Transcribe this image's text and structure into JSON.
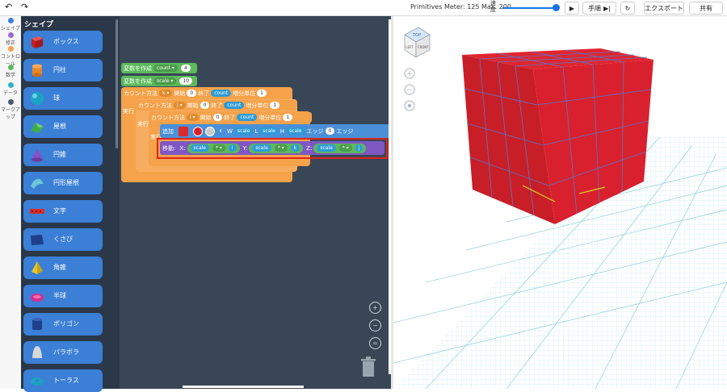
{
  "topbar": {
    "undo": "↶",
    "redo": "↷",
    "primitives_meter": "Primitives Meter: 125 Max. 200",
    "speed_label": "速度",
    "speed_value": 0.95,
    "play": "▶",
    "step_label": "手順",
    "reset": "↻",
    "export_label": "エクスポート",
    "share_label": "共有"
  },
  "rail": [
    {
      "label": "シェイプ",
      "color": "#3b7fd6"
    },
    {
      "label": "修正",
      "color": "#9a6bd6"
    },
    {
      "label": "コントロール",
      "color": "#f5a24a"
    },
    {
      "label": "数学",
      "color": "#5cb95c"
    },
    {
      "label": "データ",
      "color": "#2db3c4"
    },
    {
      "label": "マークアップ",
      "color": "#4b5a6b"
    }
  ],
  "palette": {
    "title": "シェイプ",
    "items": [
      {
        "label": "ボックス",
        "icon": "box-icon",
        "color": "#d92b2b"
      },
      {
        "label": "円柱",
        "icon": "cylinder-icon",
        "color": "#e8862a"
      },
      {
        "label": "球",
        "icon": "sphere-icon",
        "color": "#1aa3c4"
      },
      {
        "label": "屋根",
        "icon": "roof-icon",
        "color": "#3fae49"
      },
      {
        "label": "円錐",
        "icon": "cone-icon",
        "color": "#8a4fc4"
      },
      {
        "label": "円形屋根",
        "icon": "round-roof-icon",
        "color": "#6ec4d9"
      },
      {
        "label": "文字",
        "icon": "text-icon",
        "color": "#d92b2b"
      },
      {
        "label": "くさび",
        "icon": "wedge-icon",
        "color": "#1f3f8a"
      },
      {
        "label": "角錐",
        "icon": "pyramid-icon",
        "color": "#e8c42a"
      },
      {
        "label": "半球",
        "icon": "half-sphere-icon",
        "color": "#d92b8a"
      },
      {
        "label": "ポリゴン",
        "icon": "polygon-icon",
        "color": "#1f3f8a"
      },
      {
        "label": "パラボラ",
        "icon": "paraboloid-icon",
        "color": "#d8d8d8"
      },
      {
        "label": "トーラス",
        "icon": "torus-icon",
        "color": "#1aa3c4"
      }
    ]
  },
  "code": {
    "var1": {
      "label": "変数を作成",
      "name": "count",
      "value": "4"
    },
    "var2": {
      "label": "変数を作成",
      "name": "scale",
      "value": "10"
    },
    "loop1": {
      "label": "カウント方法",
      "var": "k",
      "start_label": "開始",
      "start": "0",
      "end_label": "終了",
      "end": "count",
      "step_label": "増分単位",
      "step": "1",
      "do": "実行"
    },
    "loop2": {
      "label": "カウント方法",
      "var": "j",
      "start_label": "開始",
      "start": "0",
      "end_label": "終了",
      "end": "count",
      "step_label": "増分単位",
      "step": "1",
      "do": "実行"
    },
    "loop3": {
      "label": "カウント方法",
      "var": "i",
      "start_label": "開始",
      "start": "0",
      "end_label": "終了",
      "end": "count",
      "step_label": "増分単位",
      "step": "1",
      "do": "実行"
    },
    "add": {
      "label": "追加",
      "w": "W",
      "w_val": "scale",
      "l": "L",
      "l_val": "scale",
      "h": "H",
      "h_val": "scale",
      "edge": "エッジ",
      "edge_val": "0",
      "edge2": "エッジ"
    },
    "move": {
      "label": "移動:",
      "x": "X:",
      "x1": "scale",
      "x_op": "*",
      "x2": "i",
      "y": "Y:",
      "y1": "scale",
      "y_op": "*",
      "y2": "k",
      "z": "Z:",
      "z1": "scale",
      "z_op": "*",
      "z2": "j"
    }
  },
  "viewcube": {
    "top": "TOP",
    "left": "LEFT",
    "front": "FRONT"
  },
  "colors": {
    "cube": "#d9202e",
    "grid": "#a8dbe8",
    "highlight": "#e2231a"
  }
}
